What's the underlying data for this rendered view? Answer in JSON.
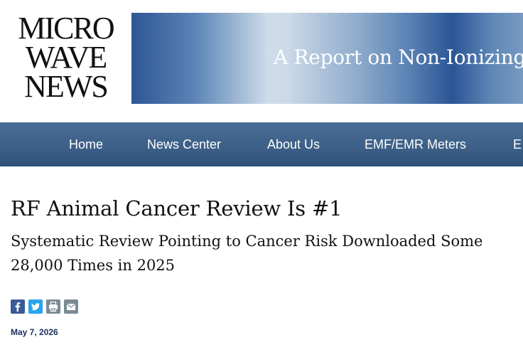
{
  "site": {
    "logo_lines": [
      "MICRO",
      "WAVE",
      "NEWS"
    ],
    "tagline": "A Report on Non-Ionizing Radiation"
  },
  "nav": {
    "items": [
      {
        "label": "Home"
      },
      {
        "label": "News Center"
      },
      {
        "label": "About Us"
      },
      {
        "label": "EMF/EMR Meters"
      },
      {
        "label": "E"
      }
    ]
  },
  "article": {
    "title": "RF Animal Cancer Review Is #1",
    "subtitle": "Systematic Review Pointing to Cancer Risk Downloaded Some 28,000 Times in 2025",
    "date": "May 7, 2026"
  },
  "share": {
    "buttons": [
      {
        "icon": "facebook-icon",
        "color": "#3b5b98"
      },
      {
        "icon": "twitter-icon",
        "color": "#2aa3ef"
      },
      {
        "icon": "print-icon",
        "color": "#7b8b94"
      },
      {
        "icon": "email-icon",
        "color": "#7b8b94"
      }
    ]
  },
  "colors": {
    "nav_background": "#3d6089",
    "date_text": "#1c2d5a",
    "banner_dark": "#2d5694",
    "banner_light": "#cfdcea"
  }
}
